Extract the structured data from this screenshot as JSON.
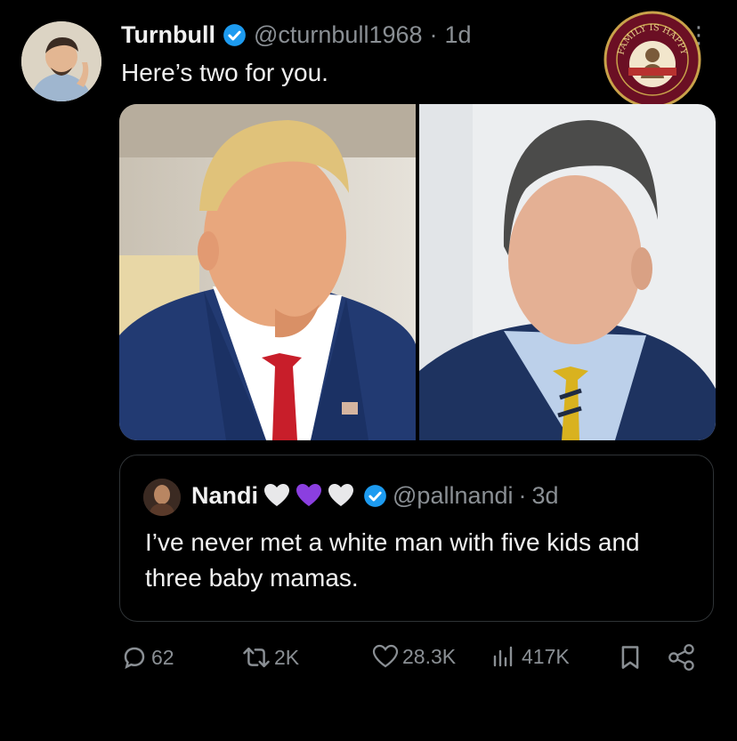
{
  "tweet": {
    "author_name": "Turnbull",
    "handle": "@cturnbull1968",
    "separator": "·",
    "time": "1d",
    "more": "⋮",
    "text": "Here’s two for you."
  },
  "watermark": {
    "text": "FAMILY IS HAPPY"
  },
  "quote": {
    "author_name": "Nandi",
    "handle": "@pallnandi",
    "separator": "·",
    "time": "3d",
    "text": "I’ve never met a white man with five kids and three baby mamas."
  },
  "actions": {
    "replies": "62",
    "reposts": "2K",
    "likes": "28.3K",
    "views": "417K"
  },
  "colors": {
    "background": "#000000",
    "verified": "#1d9bf0",
    "muted": "#8a8f94",
    "purple_heart": "#8b3fe0"
  }
}
